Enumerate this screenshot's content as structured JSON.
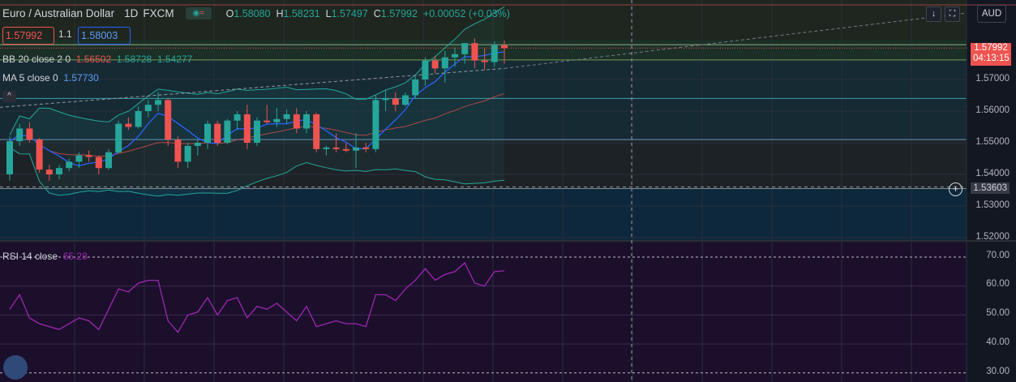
{
  "header": {
    "symbol": "Euro / Australian Dollar",
    "timeframe": "1D",
    "exchange": "FXCM",
    "ohlc": {
      "o_label": "O",
      "o": "1.58080",
      "h_label": "H",
      "h": "1.58231",
      "l_label": "L",
      "l": "1.57497",
      "c_label": "C",
      "c": "1.57992",
      "change": "+0.00052 (+0.03%)"
    }
  },
  "quotes": {
    "bid": "1.57992",
    "spread": "1.1",
    "ask": "1.58003"
  },
  "indicators": {
    "bb": {
      "label": "BB 20 close 2 0",
      "basis": "1.56502",
      "upper": "1.58728",
      "lower": "1.54277"
    },
    "ma": {
      "label": "MA 5 close 0",
      "value": "1.57730"
    },
    "rsi": {
      "label": "RSI 14 close",
      "value": "65.28"
    }
  },
  "controls": {
    "currency": "AUD",
    "collapse": "^",
    "arrow": "↓",
    "screen": "⛶"
  },
  "price_axis": {
    "labels": [
      "1.57000",
      "1.56000",
      "1.55000",
      "1.54000",
      "1.53000",
      "1.52000"
    ],
    "current_price": "1.57992",
    "countdown": "04:13:15",
    "crosshair_price": "1.53603"
  },
  "rsi_axis": {
    "labels": [
      "70.00",
      "60.00",
      "50.00",
      "40.00",
      "30.00"
    ]
  },
  "colors": {
    "bg": "#131722",
    "up": "#26a69a",
    "down": "#ef5350",
    "rsi": "#9c27b0",
    "ma": "#2962ff",
    "bb_basis": "#ef5350",
    "bb_band": "#26a69a"
  },
  "chart_data": {
    "type": "candlestick",
    "price_range": [
      1.52,
      1.58231
    ],
    "candles": [
      {
        "o": 1.54,
        "h": 1.552,
        "l": 1.538,
        "c": 1.5505
      },
      {
        "o": 1.5505,
        "h": 1.556,
        "l": 1.549,
        "c": 1.5545
      },
      {
        "o": 1.5545,
        "h": 1.5565,
        "l": 1.55,
        "c": 1.551
      },
      {
        "o": 1.551,
        "h": 1.5515,
        "l": 1.5405,
        "c": 1.5415
      },
      {
        "o": 1.5415,
        "h": 1.543,
        "l": 1.538,
        "c": 1.54
      },
      {
        "o": 1.54,
        "h": 1.543,
        "l": 1.5385,
        "c": 1.542
      },
      {
        "o": 1.542,
        "h": 1.545,
        "l": 1.541,
        "c": 1.544
      },
      {
        "o": 1.544,
        "h": 1.547,
        "l": 1.542,
        "c": 1.546
      },
      {
        "o": 1.546,
        "h": 1.5475,
        "l": 1.544,
        "c": 1.5455
      },
      {
        "o": 1.5455,
        "h": 1.546,
        "l": 1.54,
        "c": 1.542
      },
      {
        "o": 1.542,
        "h": 1.548,
        "l": 1.5415,
        "c": 1.547
      },
      {
        "o": 1.547,
        "h": 1.557,
        "l": 1.5465,
        "c": 1.556
      },
      {
        "o": 1.556,
        "h": 1.558,
        "l": 1.554,
        "c": 1.555
      },
      {
        "o": 1.555,
        "h": 1.5615,
        "l": 1.5545,
        "c": 1.56
      },
      {
        "o": 1.56,
        "h": 1.5635,
        "l": 1.558,
        "c": 1.562
      },
      {
        "o": 1.562,
        "h": 1.566,
        "l": 1.56,
        "c": 1.5635
      },
      {
        "o": 1.5635,
        "h": 1.564,
        "l": 1.549,
        "c": 1.551
      },
      {
        "o": 1.551,
        "h": 1.552,
        "l": 1.542,
        "c": 1.544
      },
      {
        "o": 1.544,
        "h": 1.55,
        "l": 1.542,
        "c": 1.549
      },
      {
        "o": 1.549,
        "h": 1.551,
        "l": 1.546,
        "c": 1.55
      },
      {
        "o": 1.55,
        "h": 1.557,
        "l": 1.548,
        "c": 1.556
      },
      {
        "o": 1.556,
        "h": 1.557,
        "l": 1.549,
        "c": 1.55
      },
      {
        "o": 1.55,
        "h": 1.5575,
        "l": 1.5495,
        "c": 1.557
      },
      {
        "o": 1.557,
        "h": 1.56,
        "l": 1.554,
        "c": 1.559
      },
      {
        "o": 1.559,
        "h": 1.562,
        "l": 1.548,
        "c": 1.55
      },
      {
        "o": 1.55,
        "h": 1.558,
        "l": 1.549,
        "c": 1.557
      },
      {
        "o": 1.557,
        "h": 1.562,
        "l": 1.556,
        "c": 1.5565
      },
      {
        "o": 1.5565,
        "h": 1.561,
        "l": 1.555,
        "c": 1.5575
      },
      {
        "o": 1.5575,
        "h": 1.5605,
        "l": 1.556,
        "c": 1.559
      },
      {
        "o": 1.559,
        "h": 1.561,
        "l": 1.553,
        "c": 1.5545
      },
      {
        "o": 1.5545,
        "h": 1.56,
        "l": 1.553,
        "c": 1.559
      },
      {
        "o": 1.559,
        "h": 1.5595,
        "l": 1.547,
        "c": 1.548
      },
      {
        "o": 1.548,
        "h": 1.549,
        "l": 1.546,
        "c": 1.5485
      },
      {
        "o": 1.5485,
        "h": 1.553,
        "l": 1.547,
        "c": 1.548
      },
      {
        "o": 1.548,
        "h": 1.55,
        "l": 1.547,
        "c": 1.5475
      },
      {
        "o": 1.5475,
        "h": 1.553,
        "l": 1.542,
        "c": 1.5485
      },
      {
        "o": 1.5485,
        "h": 1.55,
        "l": 1.547,
        "c": 1.548
      },
      {
        "o": 1.548,
        "h": 1.565,
        "l": 1.547,
        "c": 1.5635
      },
      {
        "o": 1.5635,
        "h": 1.5665,
        "l": 1.56,
        "c": 1.564
      },
      {
        "o": 1.564,
        "h": 1.566,
        "l": 1.56,
        "c": 1.562
      },
      {
        "o": 1.562,
        "h": 1.566,
        "l": 1.5615,
        "c": 1.565
      },
      {
        "o": 1.565,
        "h": 1.571,
        "l": 1.564,
        "c": 1.57
      },
      {
        "o": 1.57,
        "h": 1.577,
        "l": 1.568,
        "c": 1.576
      },
      {
        "o": 1.576,
        "h": 1.5775,
        "l": 1.572,
        "c": 1.5735
      },
      {
        "o": 1.5735,
        "h": 1.579,
        "l": 1.569,
        "c": 1.577
      },
      {
        "o": 1.577,
        "h": 1.58,
        "l": 1.574,
        "c": 1.578
      },
      {
        "o": 1.578,
        "h": 1.5815,
        "l": 1.575,
        "c": 1.5815
      },
      {
        "o": 1.5815,
        "h": 1.583,
        "l": 1.5735,
        "c": 1.576
      },
      {
        "o": 1.576,
        "h": 1.58,
        "l": 1.573,
        "c": 1.5755
      },
      {
        "o": 1.5755,
        "h": 1.582,
        "l": 1.574,
        "c": 1.5808
      },
      {
        "o": 1.5808,
        "h": 1.58231,
        "l": 1.57497,
        "c": 1.57992
      }
    ],
    "rsi": [
      52,
      57,
      49,
      47,
      46,
      45,
      47,
      49,
      48,
      45,
      52,
      59,
      58,
      61,
      62,
      62,
      48,
      44,
      50,
      51,
      56,
      50,
      55,
      56,
      49,
      53,
      52,
      54,
      51,
      48,
      53,
      46,
      47,
      48,
      47,
      47,
      46,
      57,
      57,
      55,
      59,
      62,
      66,
      62,
      64,
      65,
      68,
      61,
      60,
      65,
      65.28
    ],
    "rsi_range": [
      28,
      75
    ],
    "rsi_levels": [
      70,
      60,
      50,
      40,
      30
    ]
  }
}
